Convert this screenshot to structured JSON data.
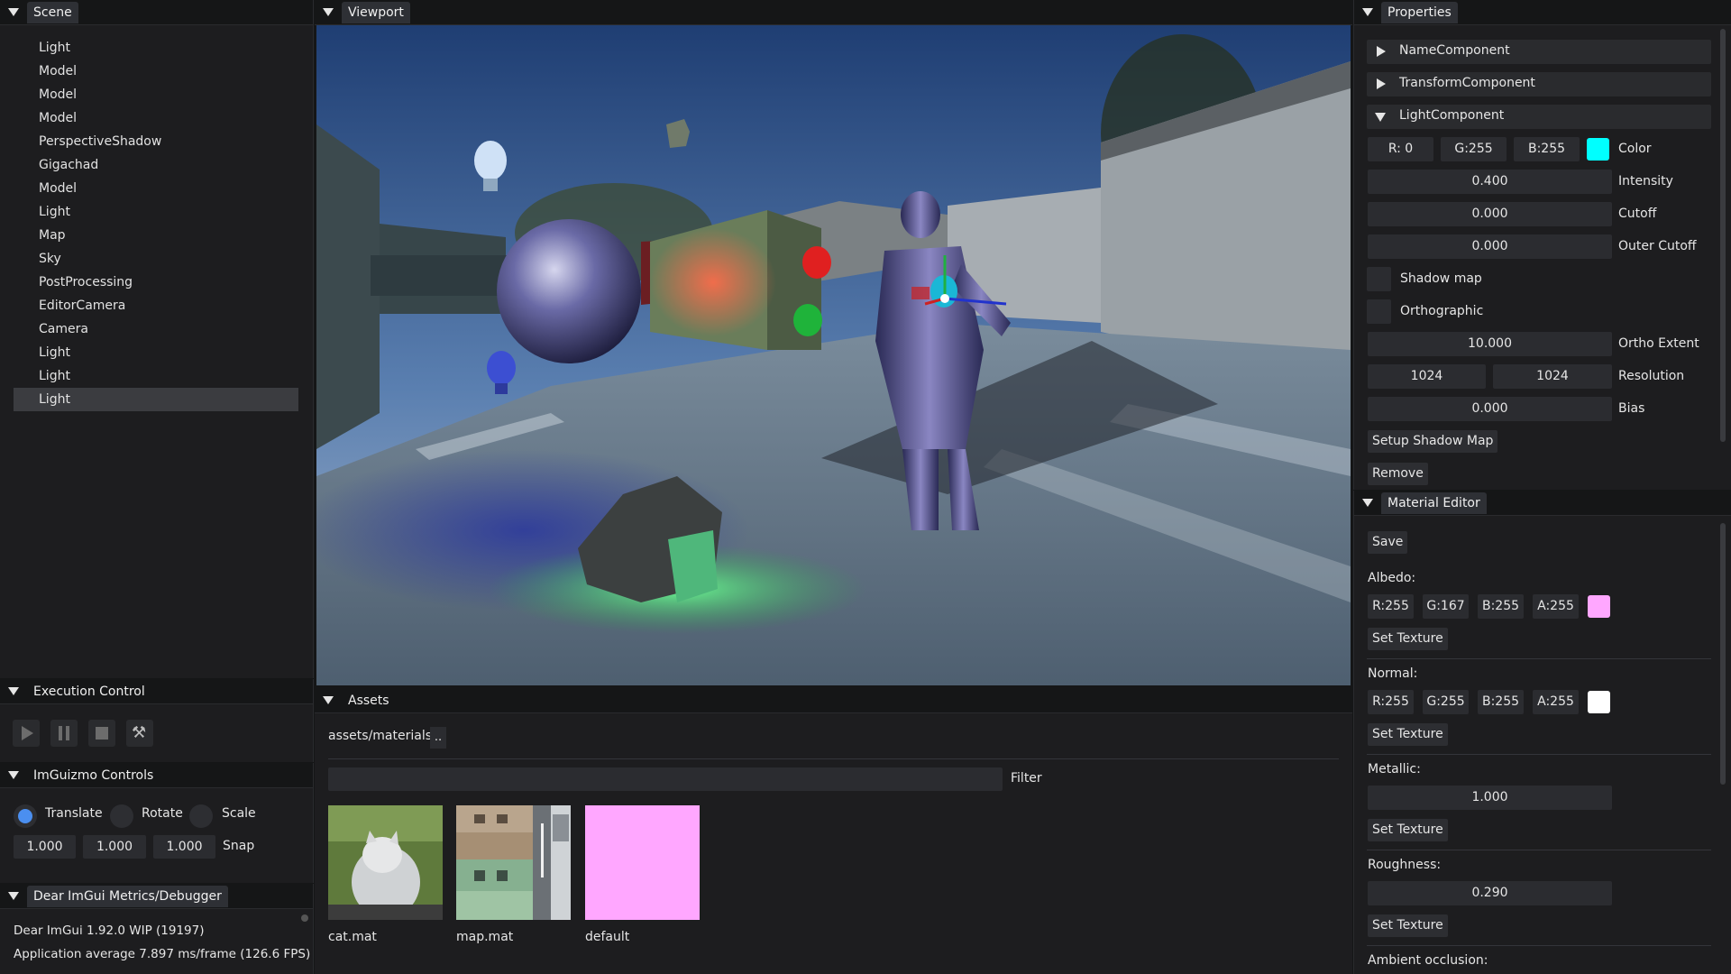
{
  "scene": {
    "title": "Scene",
    "items": [
      "Light",
      "Model",
      "Model",
      "Model",
      "PerspectiveShadow",
      "Gigachad",
      "Model",
      "Light",
      "Map",
      "Sky",
      "PostProcessing",
      "EditorCamera",
      "Camera",
      "Light",
      "Light",
      "Light"
    ],
    "selected_index": 15
  },
  "viewport": {
    "title": "Viewport"
  },
  "exec": {
    "title": "Execution Control",
    "icons": [
      "play-icon",
      "pause-icon",
      "stop-icon",
      "hammer-icon"
    ]
  },
  "gizmo": {
    "title": "ImGuizmo Controls",
    "modes": [
      "Translate",
      "Rotate",
      "Scale"
    ],
    "selected_mode": "Translate",
    "snap": [
      "1.000",
      "1.000",
      "1.000"
    ],
    "snap_label": "Snap"
  },
  "metrics": {
    "title": "Dear ImGui Metrics/Debugger",
    "line1": "Dear ImGui 1.92.0 WIP (19197)",
    "line2": "Application average 7.897 ms/frame (126.6 FPS)"
  },
  "assets": {
    "title": "Assets",
    "path": "assets/materials",
    "up_label": "..",
    "filter_label": "Filter",
    "items": [
      "cat.mat",
      "map.mat",
      "default"
    ]
  },
  "properties": {
    "title": "Properties",
    "components": [
      "NameComponent",
      "TransformComponent",
      "LightComponent"
    ],
    "color": {
      "r": "R:  0",
      "g": "G:255",
      "b": "B:255",
      "label": "Color",
      "swatch": "#00ffff"
    },
    "intensity": {
      "value": "0.400",
      "label": "Intensity"
    },
    "cutoff": {
      "value": "0.000",
      "label": "Cutoff"
    },
    "outer_cutoff": {
      "value": "0.000",
      "label": "Outer Cutoff"
    },
    "shadow_map_label": "Shadow map",
    "orthographic_label": "Orthographic",
    "ortho_extent": {
      "value": "10.000",
      "label": "Ortho Extent"
    },
    "resolution": {
      "w": "1024",
      "h": "1024",
      "label": "Resolution"
    },
    "bias": {
      "value": "0.000",
      "label": "Bias"
    },
    "setup_shadow_button": "Setup Shadow Map",
    "remove_button": "Remove"
  },
  "material": {
    "title": "Material Editor",
    "save_button": "Save",
    "albedo": {
      "label": "Albedo:",
      "r": "R:255",
      "g": "G:167",
      "b": "B:255",
      "a": "A:255",
      "swatch": "#ffa7ff"
    },
    "normal": {
      "label": "Normal:",
      "r": "R:255",
      "g": "G:255",
      "b": "B:255",
      "a": "A:255",
      "swatch": "#ffffff"
    },
    "metallic": {
      "label": "Metallic:",
      "value": "1.000"
    },
    "roughness": {
      "label": "Roughness:",
      "value": "0.290"
    },
    "ambient_label": "Ambient occlusion:",
    "set_texture": "Set Texture"
  }
}
